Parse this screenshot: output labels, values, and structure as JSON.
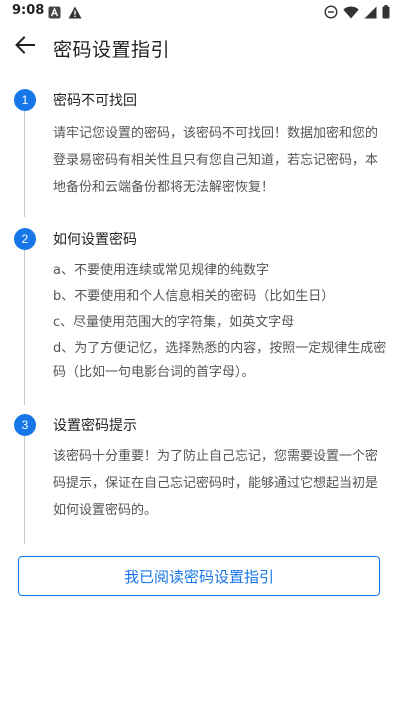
{
  "status_bar": {
    "time": "9:08",
    "icons": [
      "notification-a-icon",
      "warning-icon",
      "do-not-disturb-icon",
      "wifi-icon",
      "signal-icon",
      "battery-icon"
    ]
  },
  "app_bar": {
    "back_icon": "arrow-left-icon",
    "title": "密码设置指引"
  },
  "steps": [
    {
      "number": "1",
      "title": "密码不可找回",
      "body": "请牢记您设置的密码，该密码不可找回！数据加密和您的登录易密码有相关性且只有您自己知道，若忘记密码，本地备份和云端备份都将无法解密恢复！"
    },
    {
      "number": "2",
      "title": "如何设置密码",
      "items": [
        "a、不要使用连续或常见规律的纯数字",
        "b、不要使用和个人信息相关的密码（比如生日）",
        "c、尽量使用范围大的字符集，如英文字母",
        "d、为了方便记忆，选择熟悉的内容，按照一定规律生成密码（比如一句电影台词的首字母）。"
      ]
    },
    {
      "number": "3",
      "title": "设置密码提示",
      "body": "该密码十分重要！为了防止自己忘记，您需要设置一个密码提示，保证在自己忘记密码时，能够通过它想起当初是如何设置密码的。"
    }
  ],
  "confirm_button": {
    "label": "我已阅读密码设置指引"
  },
  "colors": {
    "accent": "#1877e8",
    "body_text": "#555555",
    "title_text": "#222222",
    "timeline": "#c8c8c8"
  }
}
